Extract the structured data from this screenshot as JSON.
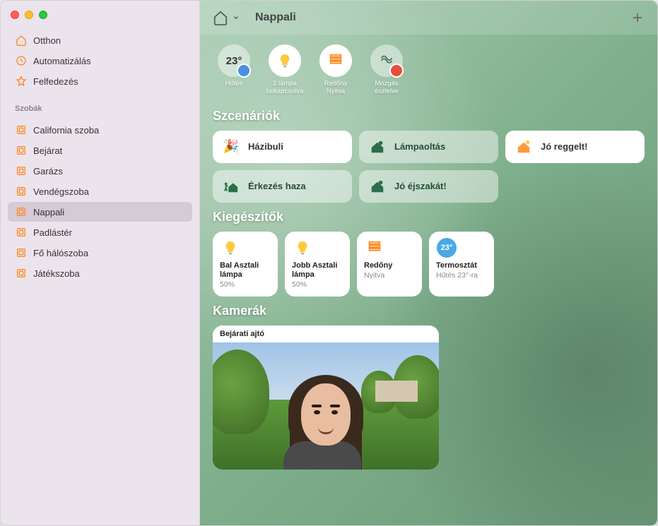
{
  "sidebar": {
    "nav": [
      {
        "label": "Otthon",
        "icon": "home"
      },
      {
        "label": "Automatizálás",
        "icon": "clock"
      },
      {
        "label": "Felfedezés",
        "icon": "star"
      }
    ],
    "rooms_header": "Szobák",
    "rooms": [
      {
        "label": "California szoba"
      },
      {
        "label": "Bejárat"
      },
      {
        "label": "Garázs"
      },
      {
        "label": "Vendégszoba"
      },
      {
        "label": "Nappali",
        "selected": true
      },
      {
        "label": "Padlástér"
      },
      {
        "label": "Fő hálószoba"
      },
      {
        "label": "Játékszoba"
      }
    ]
  },
  "header": {
    "title": "Nappali"
  },
  "status": [
    {
      "value": "23°",
      "label": "Hűtés",
      "kind": "temp"
    },
    {
      "icon": "bulb",
      "label": "2 lámpa bekapcsolva",
      "kind": "on"
    },
    {
      "icon": "blinds",
      "label": "Redőny Nyitva",
      "kind": "on"
    },
    {
      "icon": "motion",
      "label": "Mozgás észlelve",
      "kind": "motion-dim"
    }
  ],
  "sections": {
    "scenes": "Szcenáriók",
    "accessories": "Kiegészítők",
    "cameras": "Kamerák"
  },
  "scenes": [
    {
      "label": "Házibuli",
      "icon": "🎉",
      "active": true
    },
    {
      "label": "Lámpaoltás",
      "icon": "moon-house",
      "active": false
    },
    {
      "label": "Jó reggelt!",
      "icon": "sun-house",
      "active": true
    },
    {
      "label": "Érkezés haza",
      "icon": "walk-house",
      "active": false
    },
    {
      "label": "Jó éjszakát!",
      "icon": "moon-house",
      "active": false
    }
  ],
  "accessories": [
    {
      "name": "Bal Asztali lámpa",
      "status": "50%",
      "icon": "bulb"
    },
    {
      "name": "Jobb Asztali lámpa",
      "status": "50%",
      "icon": "bulb"
    },
    {
      "name": "Redőny",
      "status": "Nyitva",
      "icon": "blinds"
    },
    {
      "name": "Termosztát",
      "status": "Hűtés 23°-ra",
      "icon": "thermo",
      "value": "23°"
    }
  ],
  "cameras": [
    {
      "name": "Bejárati ajtó"
    }
  ]
}
